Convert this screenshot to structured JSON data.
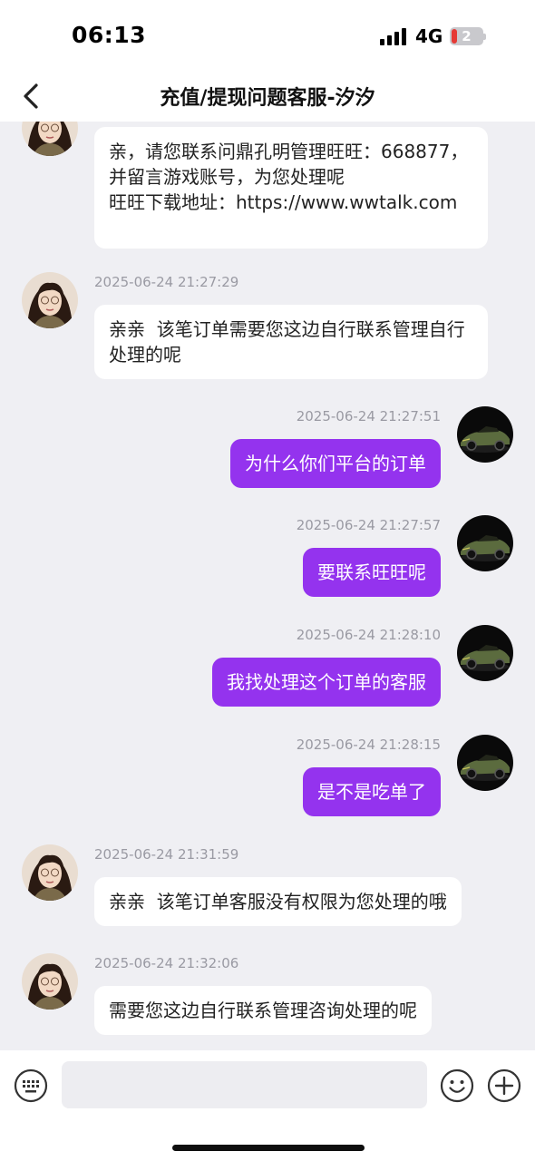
{
  "status_bar": {
    "time": "06:13",
    "network": "4G",
    "battery_level": "2"
  },
  "header": {
    "title": "充值/提现问题客服-汐汐",
    "back_icon": "chevron-left-icon"
  },
  "messages": [
    {
      "side": "left",
      "timestamp": "",
      "text": "亲，请您联系问鼎孔明管理旺旺：668877，并留言游戏账号，为您处理呢\n旺旺下载地址：https://www.wwtalk.com"
    },
    {
      "side": "left",
      "timestamp": "2025-06-24 21:27:29",
      "text": "亲亲  该笔订单需要您这边自行联系管理自行处理的呢"
    },
    {
      "side": "right",
      "timestamp": "2025-06-24 21:27:51",
      "text": "为什么你们平台的订单"
    },
    {
      "side": "right",
      "timestamp": "2025-06-24 21:27:57",
      "text": "要联系旺旺呢"
    },
    {
      "side": "right",
      "timestamp": "2025-06-24 21:28:10",
      "text": "我找处理这个订单的客服"
    },
    {
      "side": "right",
      "timestamp": "2025-06-24 21:28:15",
      "text": "是不是吃单了"
    },
    {
      "side": "left",
      "timestamp": "2025-06-24 21:31:59",
      "text": "亲亲  该笔订单客服没有权限为您处理的哦"
    },
    {
      "side": "left",
      "timestamp": "2025-06-24 21:32:06",
      "text": "需要您这边自行联系管理咨询处理的呢"
    }
  ],
  "input_bar": {
    "placeholder": "",
    "keyboard_icon": "keyboard-icon",
    "emoji_icon": "smiley-icon",
    "add_icon": "plus-circle-icon"
  },
  "colors": {
    "outgoing_bubble": "#9433ee",
    "incoming_bubble": "#ffffff",
    "chat_background": "#efeff3",
    "timestamp": "#9a9aa3"
  }
}
